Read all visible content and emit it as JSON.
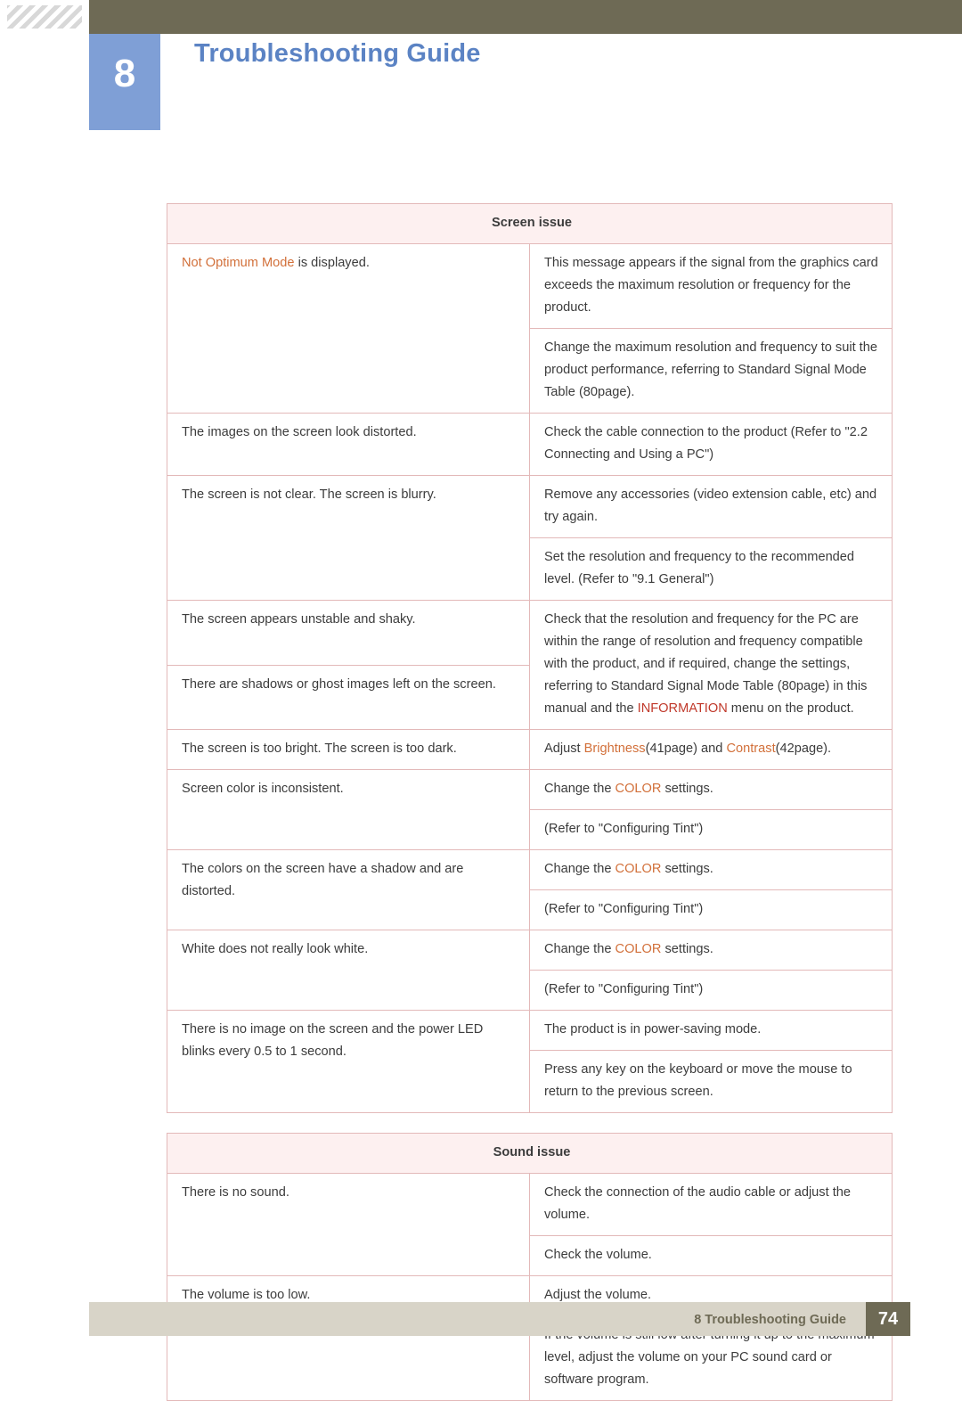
{
  "header": {
    "chapter_number": "8",
    "chapter_title": "Troubleshooting Guide"
  },
  "footer": {
    "label": "8 Troubleshooting Guide",
    "page_number": "74"
  },
  "sections": [
    {
      "heading": "Screen issue",
      "rows": [
        {
          "left": "is displayed.",
          "left_highlight": "Not Optimum Mode",
          "right": "This message appears if the signal from the graphics card exceeds the maximum resolution or frequency for the product."
        },
        {
          "left": "",
          "right": "Change the maximum resolution and frequency to suit the product performance, referring to Standard Signal Mode Table (80page)."
        },
        {
          "left": "The images on the screen look distorted.",
          "right": "Check the cable connection to the product (Refer to \"2.2 Connecting and Using a PC\")"
        },
        {
          "left": "The screen is not clear. The screen is blurry.",
          "right": "Remove any accessories (video extension cable, etc) and try again."
        },
        {
          "left": "",
          "right": "Set the resolution and frequency to the recommended level. (Refer to \"9.1 General\")"
        },
        {
          "left": "The screen appears unstable and shaky.",
          "right": "Check that the resolution and frequency for the PC are within the range of resolution and frequency compatible with the product, and if required, change the settings, referring to Standard Signal Mode Table (80page) in this manual and the INFORMATION menu on the product."
        },
        {
          "left": "There are shadows or ghost images left on the screen.",
          "right": ""
        },
        {
          "left": "The screen is too bright. The screen is too dark.",
          "right": "Adjust Brightness(41page) and Contrast(42page)."
        },
        {
          "left": "Screen color is inconsistent.",
          "right": "Change the COLOR settings."
        },
        {
          "left": "",
          "right": "(Refer to \"Configuring Tint\")"
        },
        {
          "left": "The colors on the screen have a shadow and are distorted.",
          "right": "Change the COLOR settings."
        },
        {
          "left": "",
          "right": "(Refer to \"Configuring Tint\")"
        },
        {
          "left": "White does not really look white.",
          "right": "Change the COLOR settings."
        },
        {
          "left": "",
          "right": "(Refer to \"Configuring Tint\")"
        },
        {
          "left": "There is no image on the screen and the power LED blinks every 0.5 to 1 second.",
          "right": "The product is in power-saving mode."
        },
        {
          "left": "",
          "right": "Press any key on the keyboard or move the mouse to return to the previous screen."
        }
      ]
    },
    {
      "heading": "Sound issue",
      "rows": [
        {
          "left": "There is no sound.",
          "right": "Check the connection of the audio cable or adjust the volume."
        },
        {
          "left": "",
          "right": "Check the volume."
        },
        {
          "left": "The volume is too low.",
          "right": "Adjust the volume."
        },
        {
          "left": "",
          "right": "If the volume is still low after turning it up to the maximum level, adjust the volume on your PC sound card or software program."
        }
      ]
    }
  ],
  "cells": {
    "r1_left_hl": "Not Optimum Mode",
    "r1_left_rest": " is displayed.",
    "r1_right": "This message appears if the signal from the graphics card exceeds the maximum resolution or frequency for the product.",
    "r2_right": "Change the maximum resolution and frequency to suit the product performance, referring to Standard Signal Mode Table (80page).",
    "r3_left": "The images on the screen look distorted.",
    "r3_right": "Check the cable connection to the product (Refer to \"2.2 Connecting and Using a PC\")",
    "r4_left": "The screen is not clear. The screen is blurry.",
    "r4_right": "Remove any accessories (video extension cable, etc) and try again.",
    "r5_right": "Set the resolution and frequency to the recommended level. (Refer to \"9.1 General\")",
    "r6_left": "The screen appears unstable and shaky.",
    "r7_left": "There are shadows or ghost images left on the screen.",
    "r6_right_a": "Check that the resolution and frequency for the PC are within the range of resolution and frequency compatible with the product, and if required, change the settings, referring to Standard Signal Mode Table (80page) in this manual and the ",
    "r6_right_hl": "INFORMATION",
    "r6_right_b": " menu on the product.",
    "r8_left": "The screen is too bright. The screen is too dark.",
    "r8_right_a": "Adjust ",
    "r8_right_hl1": "Brightness",
    "r8_right_b": "(41page) and ",
    "r8_right_hl2": "Contrast",
    "r8_right_c": "(42page).",
    "r9_left": "Screen color is inconsistent.",
    "change_the": "Change the ",
    "color_word": "COLOR",
    "settings_word": " settings.",
    "refer_tint": "(Refer to \"Configuring Tint\")",
    "r11_left": "The colors on the screen have a shadow and are distorted.",
    "r13_left": "White does not really look white.",
    "r15_left": "There is no image on the screen and the power LED blinks every 0.5 to 1 second.",
    "r15_right": "The product is in power-saving mode.",
    "r16_right": "Press any key on the keyboard or move the mouse to return to the previous screen.",
    "s1_left": "There is no sound.",
    "s1_right": "Check the connection of the audio cable or adjust the volume.",
    "s2_right": "Check the volume.",
    "s3_left": "The volume is too low.",
    "s3_right": "Adjust the volume.",
    "s4_right": "If the volume is still low after turning it up to the maximum level, adjust the volume on your PC sound card or software program."
  },
  "colors": {
    "header_bar": "#6e6a55",
    "chapter_badge": "#7f9fd6",
    "title_text": "#5b83c4",
    "table_border": "#e3b9b9",
    "section_head_bg": "#fdf0f0",
    "section_head_text": "#c4531f",
    "highlight": "#d2703a",
    "footer_bar": "#d8d4c8"
  }
}
